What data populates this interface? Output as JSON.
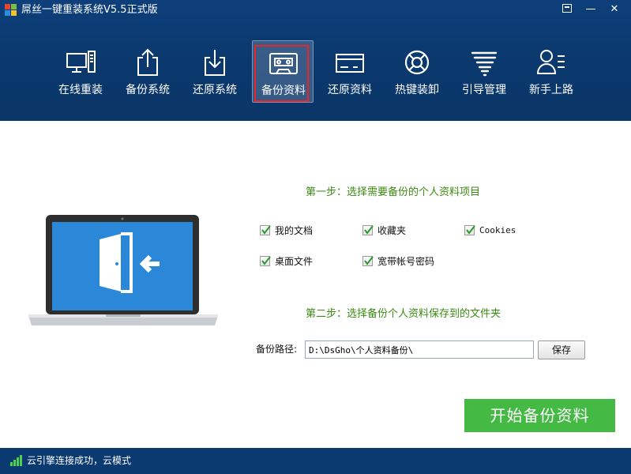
{
  "window": {
    "title": "屌丝一键重装系统V5.5正式版",
    "controls": [
      "menu",
      "minimize",
      "close"
    ]
  },
  "nav": {
    "items": [
      {
        "label": "在线重装",
        "icon": "computer-icon"
      },
      {
        "label": "备份系统",
        "icon": "upload-icon"
      },
      {
        "label": "还原系统",
        "icon": "download-icon"
      },
      {
        "label": "备份资料",
        "icon": "cassette-icon",
        "active": true
      },
      {
        "label": "还原资料",
        "icon": "card-icon"
      },
      {
        "label": "热键装卸",
        "icon": "lifebuoy-icon"
      },
      {
        "label": "引导管理",
        "icon": "tornado-icon"
      },
      {
        "label": "新手上路",
        "icon": "user-list-icon"
      }
    ]
  },
  "main": {
    "step1": "第一步：选择需要备份的个人资料项目",
    "options": [
      {
        "label": "我的文档",
        "checked": true
      },
      {
        "label": "收藏夹",
        "checked": true
      },
      {
        "label": "Cookies",
        "checked": true
      },
      {
        "label": "桌面文件",
        "checked": true
      },
      {
        "label": "宽带帐号密码",
        "checked": true
      }
    ],
    "step2": "第二步：选择备份个人资料保存到的文件夹",
    "path_label": "备份路径:",
    "path_value": "D:\\DsGho\\个人资料备份\\",
    "save_label": "保存",
    "start_label": "开始备份资料"
  },
  "status": {
    "text": "云引擎连接成功，云模式"
  },
  "colors": {
    "header": "#0b3a70",
    "accent_green": "#44b944",
    "step_green": "#3c8a14",
    "highlight_red": "#e5252a",
    "laptop_screen": "#2b87d8"
  }
}
